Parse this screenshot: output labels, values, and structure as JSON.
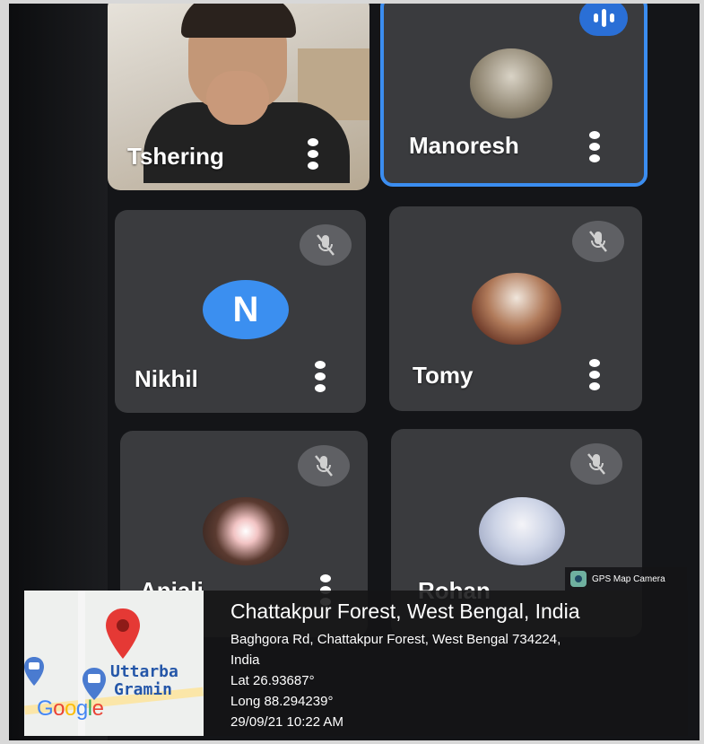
{
  "participants": [
    {
      "name": "Tshering",
      "state": "video"
    },
    {
      "name": "Manoresh",
      "state": "speaking"
    },
    {
      "name": "Nikhil",
      "state": "muted",
      "initial": "N"
    },
    {
      "name": "Tomy",
      "state": "muted"
    },
    {
      "name": "Anjali",
      "state": "muted"
    },
    {
      "name": "Rohan",
      "state": "muted"
    }
  ],
  "gps": {
    "badge": "GPS Map Camera",
    "place": "Chattakpur Forest, West Bengal, India",
    "address": "Baghgora Rd, Chattakpur Forest, West Bengal 734224,",
    "country": "India",
    "lat": "Lat 26.93687°",
    "long": "Long 88.294239°",
    "datetime": "29/09/21 10:22 AM",
    "map_label_1": "Uttarba",
    "map_label_2": "Gramin",
    "map_brand": "Google"
  },
  "colors": {
    "accent_blue": "#3b8df0",
    "tile_bg": "#3a3b3e",
    "screen_bg": "#141518"
  }
}
